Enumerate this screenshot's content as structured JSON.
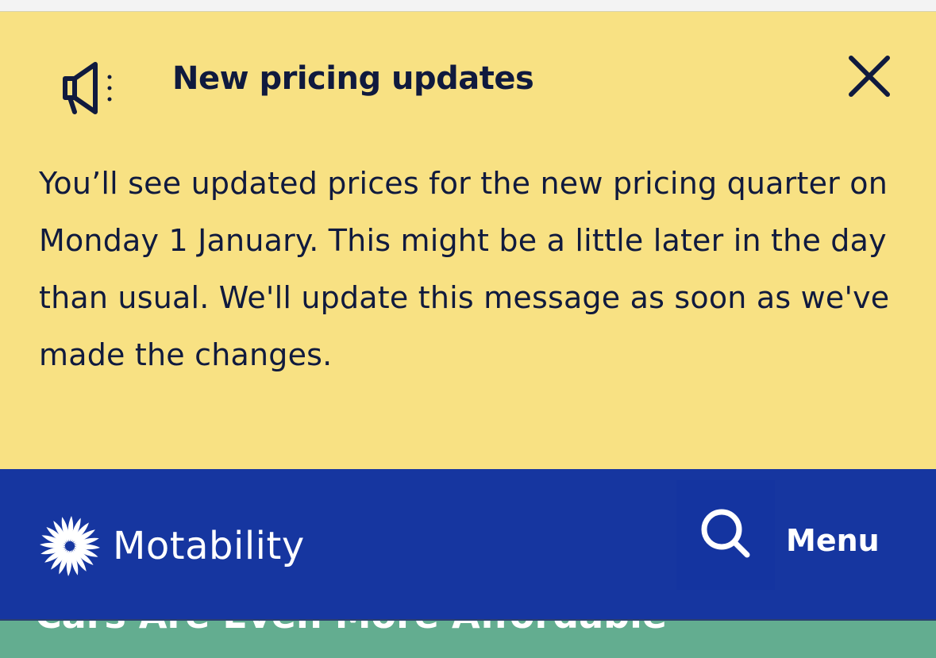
{
  "banner": {
    "title": "New pricing updates",
    "message": "You’ll see updated prices for the new pricing quarter on Monday 1 January. This might be a little later in the day than usual. We'll update this message as soon as we've made the changes.",
    "icon": "megaphone-icon",
    "close_icon": "close-icon",
    "background": "#f8e183",
    "text_color": "#101a3e"
  },
  "header": {
    "brand_name": "Motability",
    "logo_icon": "motability-starburst-logo",
    "search_icon": "search-icon",
    "menu_label": "Menu",
    "background": "#1636a0"
  },
  "hero": {
    "partial_text": "Cars Are Even More Affordable",
    "background": "#63ad90"
  }
}
